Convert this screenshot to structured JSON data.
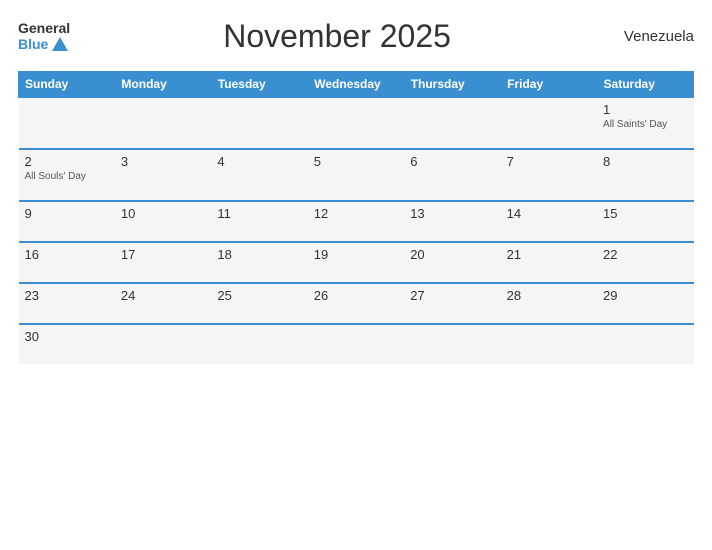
{
  "header": {
    "logo": {
      "general": "General",
      "blue": "Blue"
    },
    "title": "November 2025",
    "country": "Venezuela"
  },
  "weekdays": [
    "Sunday",
    "Monday",
    "Tuesday",
    "Wednesday",
    "Thursday",
    "Friday",
    "Saturday"
  ],
  "weeks": [
    [
      {
        "day": "",
        "holiday": ""
      },
      {
        "day": "",
        "holiday": ""
      },
      {
        "day": "",
        "holiday": ""
      },
      {
        "day": "",
        "holiday": ""
      },
      {
        "day": "",
        "holiday": ""
      },
      {
        "day": "",
        "holiday": ""
      },
      {
        "day": "1",
        "holiday": "All Saints' Day"
      }
    ],
    [
      {
        "day": "2",
        "holiday": "All Souls' Day"
      },
      {
        "day": "3",
        "holiday": ""
      },
      {
        "day": "4",
        "holiday": ""
      },
      {
        "day": "5",
        "holiday": ""
      },
      {
        "day": "6",
        "holiday": ""
      },
      {
        "day": "7",
        "holiday": ""
      },
      {
        "day": "8",
        "holiday": ""
      }
    ],
    [
      {
        "day": "9",
        "holiday": ""
      },
      {
        "day": "10",
        "holiday": ""
      },
      {
        "day": "11",
        "holiday": ""
      },
      {
        "day": "12",
        "holiday": ""
      },
      {
        "day": "13",
        "holiday": ""
      },
      {
        "day": "14",
        "holiday": ""
      },
      {
        "day": "15",
        "holiday": ""
      }
    ],
    [
      {
        "day": "16",
        "holiday": ""
      },
      {
        "day": "17",
        "holiday": ""
      },
      {
        "day": "18",
        "holiday": ""
      },
      {
        "day": "19",
        "holiday": ""
      },
      {
        "day": "20",
        "holiday": ""
      },
      {
        "day": "21",
        "holiday": ""
      },
      {
        "day": "22",
        "holiday": ""
      }
    ],
    [
      {
        "day": "23",
        "holiday": ""
      },
      {
        "day": "24",
        "holiday": ""
      },
      {
        "day": "25",
        "holiday": ""
      },
      {
        "day": "26",
        "holiday": ""
      },
      {
        "day": "27",
        "holiday": ""
      },
      {
        "day": "28",
        "holiday": ""
      },
      {
        "day": "29",
        "holiday": ""
      }
    ],
    [
      {
        "day": "30",
        "holiday": ""
      },
      {
        "day": "",
        "holiday": ""
      },
      {
        "day": "",
        "holiday": ""
      },
      {
        "day": "",
        "holiday": ""
      },
      {
        "day": "",
        "holiday": ""
      },
      {
        "day": "",
        "holiday": ""
      },
      {
        "day": "",
        "holiday": ""
      }
    ]
  ]
}
